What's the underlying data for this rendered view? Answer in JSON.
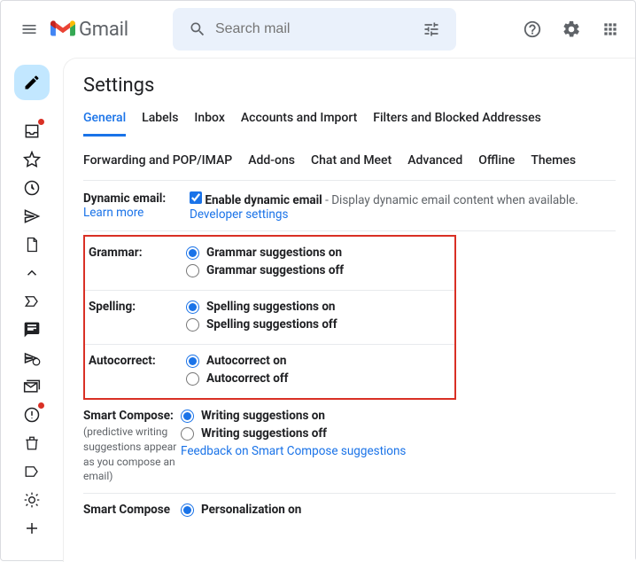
{
  "app": {
    "name": "Gmail"
  },
  "search": {
    "placeholder": "Search mail"
  },
  "page": {
    "title": "Settings"
  },
  "tabs1": {
    "general": "General",
    "labels": "Labels",
    "inbox": "Inbox",
    "accounts": "Accounts and Import",
    "filters": "Filters and Blocked Addresses"
  },
  "tabs2": {
    "forwarding": "Forwarding and POP/IMAP",
    "addons": "Add-ons",
    "chat": "Chat and Meet",
    "advanced": "Advanced",
    "offline": "Offline",
    "themes": "Themes"
  },
  "dynamic": {
    "label": "Dynamic email:",
    "checkbox_label": "Enable dynamic email",
    "desc": " - Display dynamic email content when available.",
    "learn_more": "Learn more",
    "dev_settings": "Developer settings"
  },
  "grammar": {
    "label": "Grammar:",
    "on": "Grammar suggestions on",
    "off": "Grammar suggestions off"
  },
  "spelling": {
    "label": "Spelling:",
    "on": "Spelling suggestions on",
    "off": "Spelling suggestions off"
  },
  "autocorrect": {
    "label": "Autocorrect:",
    "on": "Autocorrect on",
    "off": "Autocorrect off"
  },
  "smart_compose": {
    "label": "Smart Compose:",
    "sub": "(predictive writing suggestions appear as you compose an email)",
    "on": "Writing suggestions on",
    "off": "Writing suggestions off",
    "feedback": "Feedback on Smart Compose suggestions"
  },
  "smart_compose_pers": {
    "label": "Smart Compose",
    "on": "Personalization on"
  }
}
